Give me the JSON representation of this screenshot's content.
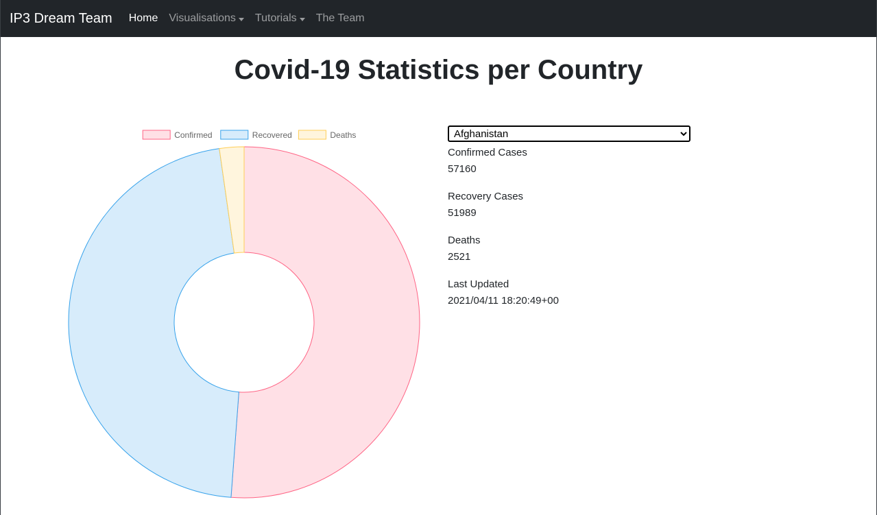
{
  "navbar": {
    "brand": "IP3 Dream Team",
    "items": [
      {
        "label": "Home",
        "active": true,
        "dropdown": false
      },
      {
        "label": "Visualisations",
        "active": false,
        "dropdown": true
      },
      {
        "label": "Tutorials",
        "active": false,
        "dropdown": true
      },
      {
        "label": "The Team",
        "active": false,
        "dropdown": false
      }
    ]
  },
  "page": {
    "title": "Covid-19 Statistics per Country"
  },
  "country_select": {
    "selected": "Afghanistan"
  },
  "stats": [
    {
      "label": "Confirmed Cases",
      "value": "57160"
    },
    {
      "label": "Recovery Cases",
      "value": "51989"
    },
    {
      "label": "Deaths",
      "value": "2521"
    },
    {
      "label": "Last Updated",
      "value": "2021/04/11 18:20:49+00"
    }
  ],
  "chart_data": {
    "type": "pie",
    "variant": "doughnut",
    "categories": [
      "Confirmed",
      "Recovered",
      "Deaths"
    ],
    "values": [
      57160,
      51989,
      2521
    ],
    "colors": {
      "fill": [
        "#ffe0e6",
        "#d7ecfb",
        "#fff5dd"
      ],
      "stroke": [
        "#ff6384",
        "#36a2eb",
        "#ffce56"
      ]
    },
    "legend": "top"
  },
  "colors": {
    "navbar_bg": "#212529",
    "text": "#212529"
  }
}
